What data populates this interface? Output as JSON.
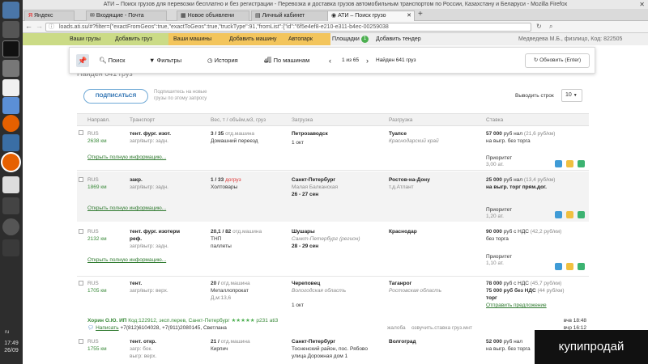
{
  "window": {
    "title": "АТИ – Поиск грузов для перевозки бесплатно и без регистрации - Перевозка и доставка грузов автомобильным транспортом по России, Казахстану и Беларуси - Mozilla Firefox"
  },
  "tabs": [
    {
      "label": "Яндекс"
    },
    {
      "label": "Входящие - Почта"
    },
    {
      "label": "Новое объявлени"
    },
    {
      "label": "Личный кабинет"
    },
    {
      "label": "АТИ – Поиск грузо"
    }
  ],
  "address": {
    "url": "loads.ati.su/#?filter={\"exactFromGeos\":true,\"exactToGeos\":true,\"truckType\":91,\"fromList\":{\"id\":\"6f5e4ef8-e210-e311-b4ec-00259038"
  },
  "nav": {
    "my_cargo": "Ваши грузы",
    "add_cargo": "Добавить груз",
    "my_trucks": "Ваши машины",
    "add_truck": "Добавить машину",
    "autopark": "Автопарк",
    "areas": "Площадки",
    "areas_badge": "1",
    "add_tender": "Добавить тендер",
    "user": "Медведева М.Б., физлицо, Код: 822505"
  },
  "toolbar": {
    "search": "Поиск",
    "filters": "Фильтры",
    "history": "История",
    "by_trucks": "По машинам",
    "page": "1 из 65",
    "found": "Найден 641 груз",
    "refresh": "Обновить (Enter)"
  },
  "subscribe": {
    "button": "ПОДПИСАТЬСЯ",
    "note1": "Подпишитесь на новые",
    "note2": "грузы по этому запросу"
  },
  "rows_per_page": {
    "label": "Выводить строк",
    "value": "10"
  },
  "behind_text": "Найден 641 груз",
  "headers": [
    "Направл.",
    "Транспорт",
    "Вес, т / объём,м3, груз",
    "Загрузка",
    "Разгрузка",
    "Ставка"
  ],
  "rows": [
    {
      "dir": "RUS",
      "km": "2638 км",
      "t1": "тент. фург. изот.",
      "t2": "загр/выгр: задн.",
      "w1": "3 / 35",
      "w1s": "отд.машина",
      "w2": "Домашний переезд",
      "w3": "",
      "l1": "Петрозаводск",
      "l2": "",
      "l3": "1 окт",
      "u1": "Туапсе",
      "u2": "Краснодарский край",
      "p1": "57 000",
      "p1s": "руб нал",
      "p1b": "(21,6 руб/км)",
      "p2": "на выгр. без торга",
      "p3": "",
      "pr": "Приоритет",
      "prv": "3,00 ат.",
      "more": "Открыть полную информацию..."
    },
    {
      "dir": "RUS",
      "km": "1869 км",
      "t1": "закр.",
      "t2": "загр/выгр: задн.",
      "w1": "1 / 33",
      "w1s": "догруз",
      "w2": "Холтовары",
      "w3": "",
      "l1": "Санкт-Петербург",
      "l2": "Малая Балканская",
      "l3": "26 - 27 сен",
      "u1": "Ростов-на-Дону",
      "u2": "т.д.Атлант",
      "p1": "25 000",
      "p1s": "руб нал",
      "p1b": "(13,4 руб/км)",
      "p2": "на выгр. торг прям.дог.",
      "p3": "",
      "pr": "Приоритет",
      "prv": "1,20 ат.",
      "more": "Открыть полную информацию..."
    },
    {
      "dir": "RUS",
      "km": "2132 км",
      "t1": "тент. фург. изотерм",
      "t1b": "реф.",
      "t2": "загр/выгр: задн.",
      "w1": "20,1 / 82",
      "w1s": "отд.машина",
      "w2": "ТНП",
      "w3": "паллеты",
      "l1": "Шушары",
      "l2": "Санкт-Петербург (регион)",
      "l3": "28 - 29 сен",
      "u1": "Краснодар",
      "u2": "",
      "p1": "90 000",
      "p1s": "руб с НДС",
      "p1b": "(42,2 руб/км)",
      "p2": "без торга",
      "p3": "",
      "pr": "Приоритет",
      "prv": "1,10 ат.",
      "more": "Открыть полную информацию..."
    },
    {
      "dir": "RUS",
      "km": "1705 км",
      "t1": "тент.",
      "t2": "загр/выгр: верх.",
      "w1": "20 /",
      "w1s": "отд.машина",
      "w2": "Металлопрокат",
      "w3": "Д,м:13,6",
      "l1": "Череповец",
      "l2": "Вологодская область",
      "l3": "1 окт",
      "u1": "Таганрог",
      "u2": "Ростовская область",
      "p1": "78 000",
      "p1s": "руб с НДС",
      "p1b": "(45,7 руб/км)",
      "p2": "75 000 руб без НДС",
      "p2b": "(44 руб/км)",
      "p3": "торг",
      "pr": "Отправить предложение",
      "prv": "",
      "more": ""
    },
    {
      "dir": "RUS",
      "km": "1755 км",
      "t1": "тент. откр.",
      "t2": "загр: бок.",
      "t3": "выгр: верх.",
      "w1": "21 /",
      "w1s": "отд.машина",
      "w2": "Кирпич",
      "w3": "",
      "l1": "Санкт-Петербург",
      "l2": "Тосненский район, пос. Рябово",
      "l3": "улица Дорожная дом 1",
      "u1": "Волгоград",
      "u2": "",
      "p1": "52 000",
      "p1s": "руб нал",
      "p1b": "",
      "p2": "на выгр. без торга",
      "p3": "",
      "pr": "",
      "prv": "",
      "more": ""
    }
  ],
  "contact": {
    "company": "Хорин О.Ю. ИП",
    "code": "Код:122912, эксп.перев, Санкт-Петербург",
    "rating": "р231",
    "extra": "ati3",
    "write": "Написать",
    "phones": "+7(812)6104028, +7(911)2080145, Светлана",
    "actions": [
      "жалоба",
      "озвучить.ставка",
      "груз.мнт"
    ],
    "time1": "вчв 18:48",
    "time2": "вчр 16:12"
  },
  "taskbar": {
    "time": "17:49",
    "date": "26/09",
    "lang": "ru"
  },
  "watermark": "купипродай"
}
